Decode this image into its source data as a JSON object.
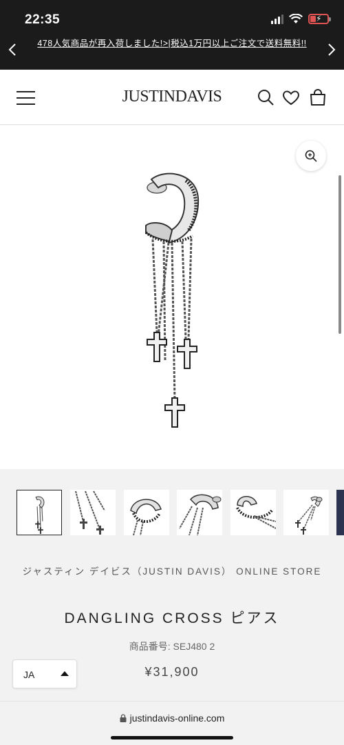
{
  "status_bar": {
    "time": "22:35"
  },
  "announcement": {
    "text": "478人気商品が再入荷しました!>|税込1万円以上ご注文で送料無料!!"
  },
  "header": {
    "logo": "JUSTINDAVIS"
  },
  "product": {
    "brand_line": "ジャスティン デイビス（JUSTIN DAVIS） ONLINE STORE",
    "title": "DANGLING CROSS ピアス",
    "sku": "商品番号: SEJ480 2",
    "price": "¥31,900",
    "thumbnail_count": 7
  },
  "language_selector": {
    "value": "JA"
  },
  "browser": {
    "url": "justindavis-online.com"
  },
  "colors": {
    "top_bar": "#1b1b1b",
    "battery": "#e05353",
    "background": "#f2f2f2"
  }
}
